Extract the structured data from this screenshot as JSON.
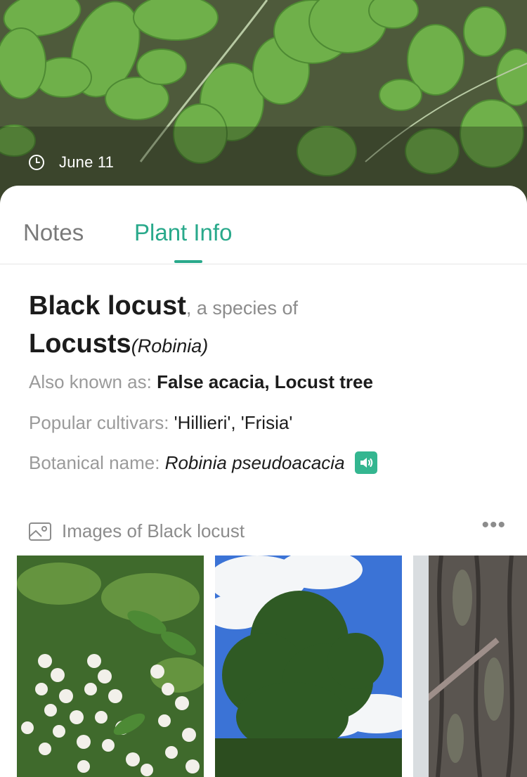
{
  "hero": {
    "date": "June 11",
    "date_icon": "clock-icon",
    "photo": "plant-leaves-photo"
  },
  "tabs": [
    {
      "label": "Notes",
      "active": false
    },
    {
      "label": "Plant Info",
      "active": true
    }
  ],
  "plant": {
    "common_name": "Black locust",
    "species_of": ", a species of",
    "genus": "Locusts",
    "genus_latin": "(Robinia)",
    "also_known_as_label": "Also known as: ",
    "also_known_as": "False acacia, Locust tree",
    "cultivars_label": "Popular cultivars: ",
    "cultivars": "'Hillieri', 'Frisia'",
    "botanical_label": "Botanical name: ",
    "botanical_name": "Robinia pseudoacacia",
    "pronounce_icon": "speaker-icon"
  },
  "images": {
    "title": "Images of Black locust",
    "title_icon": "image-icon",
    "more_label": "•••",
    "items": [
      {
        "name": "white-flower-clusters-photo"
      },
      {
        "name": "tree-against-sky-photo"
      },
      {
        "name": "bark-closeup-photo"
      }
    ]
  },
  "colors": {
    "accent": "#29a98b",
    "speaker_bg": "#34b690",
    "text_primary": "#1c1c1c",
    "text_secondary": "#8c8c8c"
  }
}
